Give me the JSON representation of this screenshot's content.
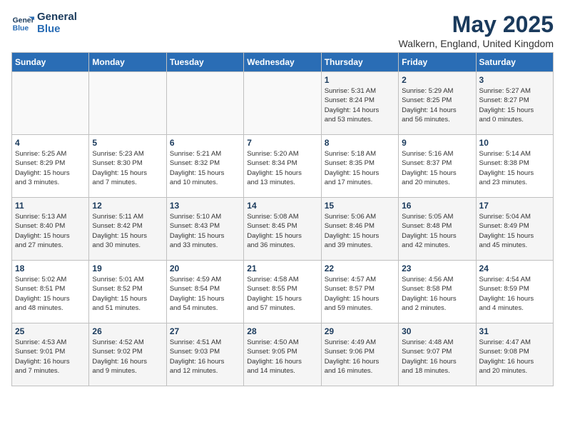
{
  "header": {
    "logo_line1": "General",
    "logo_line2": "Blue",
    "month_title": "May 2025",
    "location": "Walkern, England, United Kingdom"
  },
  "weekdays": [
    "Sunday",
    "Monday",
    "Tuesday",
    "Wednesday",
    "Thursday",
    "Friday",
    "Saturday"
  ],
  "weeks": [
    [
      {
        "day": "",
        "info": ""
      },
      {
        "day": "",
        "info": ""
      },
      {
        "day": "",
        "info": ""
      },
      {
        "day": "",
        "info": ""
      },
      {
        "day": "1",
        "info": "Sunrise: 5:31 AM\nSunset: 8:24 PM\nDaylight: 14 hours\nand 53 minutes."
      },
      {
        "day": "2",
        "info": "Sunrise: 5:29 AM\nSunset: 8:25 PM\nDaylight: 14 hours\nand 56 minutes."
      },
      {
        "day": "3",
        "info": "Sunrise: 5:27 AM\nSunset: 8:27 PM\nDaylight: 15 hours\nand 0 minutes."
      }
    ],
    [
      {
        "day": "4",
        "info": "Sunrise: 5:25 AM\nSunset: 8:29 PM\nDaylight: 15 hours\nand 3 minutes."
      },
      {
        "day": "5",
        "info": "Sunrise: 5:23 AM\nSunset: 8:30 PM\nDaylight: 15 hours\nand 7 minutes."
      },
      {
        "day": "6",
        "info": "Sunrise: 5:21 AM\nSunset: 8:32 PM\nDaylight: 15 hours\nand 10 minutes."
      },
      {
        "day": "7",
        "info": "Sunrise: 5:20 AM\nSunset: 8:34 PM\nDaylight: 15 hours\nand 13 minutes."
      },
      {
        "day": "8",
        "info": "Sunrise: 5:18 AM\nSunset: 8:35 PM\nDaylight: 15 hours\nand 17 minutes."
      },
      {
        "day": "9",
        "info": "Sunrise: 5:16 AM\nSunset: 8:37 PM\nDaylight: 15 hours\nand 20 minutes."
      },
      {
        "day": "10",
        "info": "Sunrise: 5:14 AM\nSunset: 8:38 PM\nDaylight: 15 hours\nand 23 minutes."
      }
    ],
    [
      {
        "day": "11",
        "info": "Sunrise: 5:13 AM\nSunset: 8:40 PM\nDaylight: 15 hours\nand 27 minutes."
      },
      {
        "day": "12",
        "info": "Sunrise: 5:11 AM\nSunset: 8:42 PM\nDaylight: 15 hours\nand 30 minutes."
      },
      {
        "day": "13",
        "info": "Sunrise: 5:10 AM\nSunset: 8:43 PM\nDaylight: 15 hours\nand 33 minutes."
      },
      {
        "day": "14",
        "info": "Sunrise: 5:08 AM\nSunset: 8:45 PM\nDaylight: 15 hours\nand 36 minutes."
      },
      {
        "day": "15",
        "info": "Sunrise: 5:06 AM\nSunset: 8:46 PM\nDaylight: 15 hours\nand 39 minutes."
      },
      {
        "day": "16",
        "info": "Sunrise: 5:05 AM\nSunset: 8:48 PM\nDaylight: 15 hours\nand 42 minutes."
      },
      {
        "day": "17",
        "info": "Sunrise: 5:04 AM\nSunset: 8:49 PM\nDaylight: 15 hours\nand 45 minutes."
      }
    ],
    [
      {
        "day": "18",
        "info": "Sunrise: 5:02 AM\nSunset: 8:51 PM\nDaylight: 15 hours\nand 48 minutes."
      },
      {
        "day": "19",
        "info": "Sunrise: 5:01 AM\nSunset: 8:52 PM\nDaylight: 15 hours\nand 51 minutes."
      },
      {
        "day": "20",
        "info": "Sunrise: 4:59 AM\nSunset: 8:54 PM\nDaylight: 15 hours\nand 54 minutes."
      },
      {
        "day": "21",
        "info": "Sunrise: 4:58 AM\nSunset: 8:55 PM\nDaylight: 15 hours\nand 57 minutes."
      },
      {
        "day": "22",
        "info": "Sunrise: 4:57 AM\nSunset: 8:57 PM\nDaylight: 15 hours\nand 59 minutes."
      },
      {
        "day": "23",
        "info": "Sunrise: 4:56 AM\nSunset: 8:58 PM\nDaylight: 16 hours\nand 2 minutes."
      },
      {
        "day": "24",
        "info": "Sunrise: 4:54 AM\nSunset: 8:59 PM\nDaylight: 16 hours\nand 4 minutes."
      }
    ],
    [
      {
        "day": "25",
        "info": "Sunrise: 4:53 AM\nSunset: 9:01 PM\nDaylight: 16 hours\nand 7 minutes."
      },
      {
        "day": "26",
        "info": "Sunrise: 4:52 AM\nSunset: 9:02 PM\nDaylight: 16 hours\nand 9 minutes."
      },
      {
        "day": "27",
        "info": "Sunrise: 4:51 AM\nSunset: 9:03 PM\nDaylight: 16 hours\nand 12 minutes."
      },
      {
        "day": "28",
        "info": "Sunrise: 4:50 AM\nSunset: 9:05 PM\nDaylight: 16 hours\nand 14 minutes."
      },
      {
        "day": "29",
        "info": "Sunrise: 4:49 AM\nSunset: 9:06 PM\nDaylight: 16 hours\nand 16 minutes."
      },
      {
        "day": "30",
        "info": "Sunrise: 4:48 AM\nSunset: 9:07 PM\nDaylight: 16 hours\nand 18 minutes."
      },
      {
        "day": "31",
        "info": "Sunrise: 4:47 AM\nSunset: 9:08 PM\nDaylight: 16 hours\nand 20 minutes."
      }
    ]
  ]
}
